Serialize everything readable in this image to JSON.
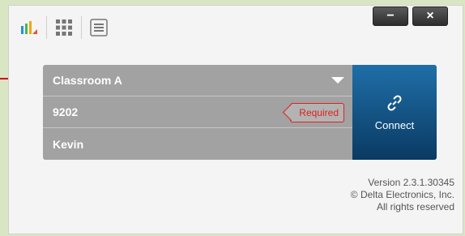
{
  "window": {
    "minimize_label": "−",
    "close_label": "×"
  },
  "toolbar": {
    "icons": [
      "app-logo-icon",
      "grid-icon",
      "menu-icon"
    ]
  },
  "form": {
    "room": "Classroom A",
    "code": "9202",
    "code_badge": "Required",
    "name": "Kevin"
  },
  "connect": {
    "label": "Connect"
  },
  "footer": {
    "version": "Version 2.3.1.30345",
    "copyright": "© Delta Electronics, Inc.",
    "rights": "All rights reserved"
  },
  "colors": {
    "background": "#d9e6c4",
    "connect_button": "#0a3a63",
    "required": "#e02020",
    "annotation": "#d0021b"
  }
}
